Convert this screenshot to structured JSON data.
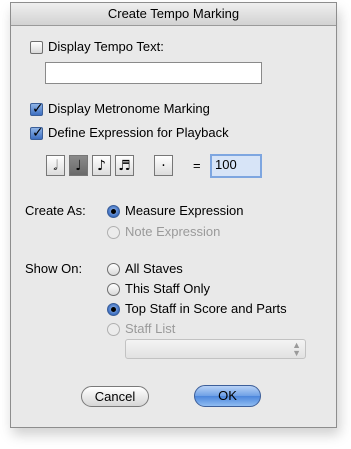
{
  "dialog": {
    "title": "Create Tempo Marking"
  },
  "tempo_text": {
    "label": "Display Tempo Text:",
    "checked": false,
    "value": ""
  },
  "metronome": {
    "label": "Display Metronome Marking",
    "checked": true
  },
  "playback": {
    "label": "Define Expression for Playback",
    "checked": true
  },
  "notes": {
    "items": [
      {
        "glyph": "𝅗𝅥",
        "name": "half-note"
      },
      {
        "glyph": "♩",
        "name": "quarter-note"
      },
      {
        "glyph": "♪",
        "name": "eighth-note"
      },
      {
        "glyph": "♬",
        "name": "sixteenth-note"
      }
    ],
    "selected": 1,
    "dot": "·",
    "equals": "=",
    "tempo_value": "100"
  },
  "create_as": {
    "label": "Create As:",
    "options": [
      {
        "label": "Measure Expression",
        "selected": true,
        "enabled": true
      },
      {
        "label": "Note Expression",
        "selected": false,
        "enabled": false
      }
    ]
  },
  "show_on": {
    "label": "Show On:",
    "options": [
      {
        "label": "All Staves",
        "selected": false,
        "enabled": true
      },
      {
        "label": "This Staff Only",
        "selected": false,
        "enabled": true
      },
      {
        "label": "Top Staff in Score and Parts",
        "selected": true,
        "enabled": true
      },
      {
        "label": "Staff List",
        "selected": false,
        "enabled": false
      }
    ],
    "staff_list_value": ""
  },
  "buttons": {
    "cancel": "Cancel",
    "ok": "OK"
  }
}
